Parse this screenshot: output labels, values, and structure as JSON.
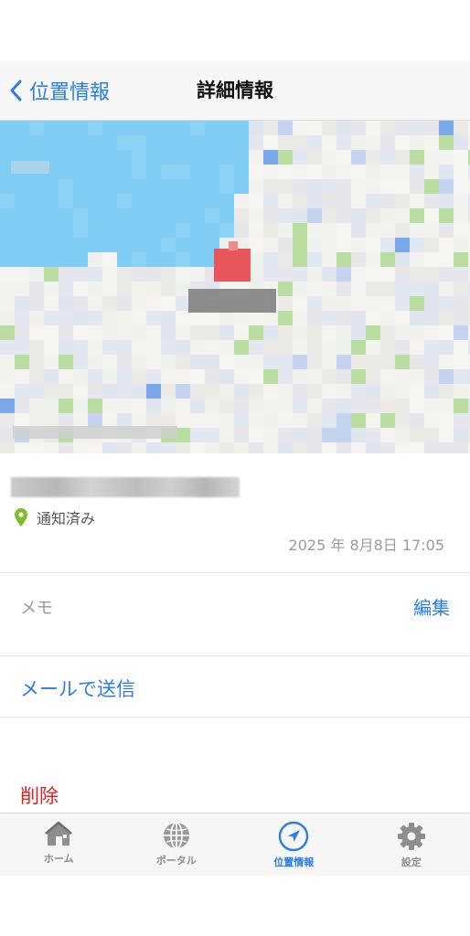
{
  "navbar": {
    "back_label": "位置情報",
    "title": "詳細情報"
  },
  "detail": {
    "status": "通知済み",
    "timestamp": "2025 年 8月8日 17:05"
  },
  "memo": {
    "label": "メモ",
    "edit_label": "編集"
  },
  "actions": {
    "mail_label": "メールで送信",
    "delete_label": "削除"
  },
  "tabbar": {
    "tabs": [
      {
        "label": "ホーム",
        "icon": "home-icon"
      },
      {
        "label": "ポータル",
        "icon": "globe-icon"
      },
      {
        "label": "位置情報",
        "icon": "location-arrow-icon",
        "active": true
      },
      {
        "label": "設定",
        "icon": "gear-icon"
      }
    ]
  },
  "colors": {
    "accent": "#2a7de1",
    "destructive": "#e02020",
    "status_pin": "#7cbf2a",
    "map_water": "#7fcdf5",
    "map_pin": "#e8555a"
  }
}
